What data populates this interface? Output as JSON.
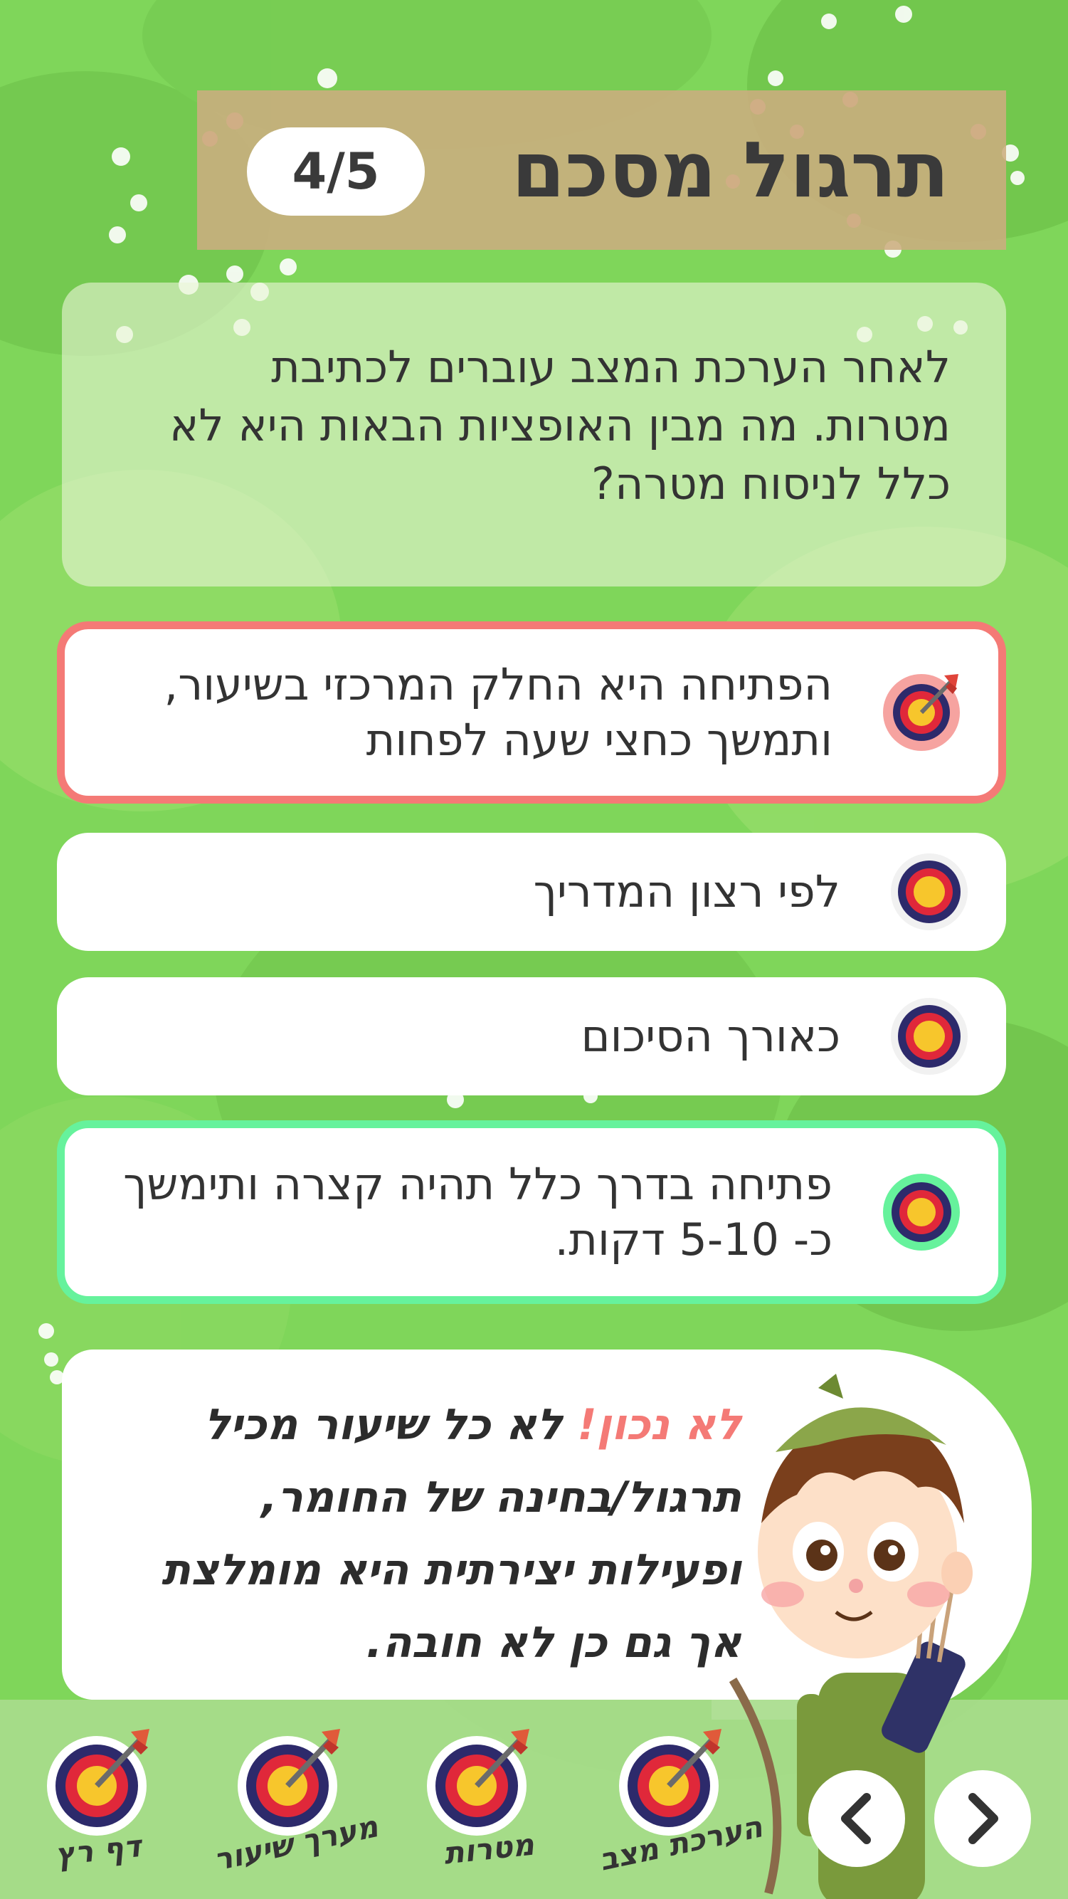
{
  "header": {
    "title": "תרגול מסכם",
    "progress": "4/5"
  },
  "question": {
    "text": "לאחר הערכת המצב עוברים לכתיבת מטרות. מה מבין האופציות הבאות היא לא כלל לניסוח מטרה?"
  },
  "answers": [
    {
      "text": "הפתיחה היא החלק המרכזי בשיעור, ותמשך כחצי שעה לפחות",
      "state": "wrong",
      "icon": "target-with-arrow-icon"
    },
    {
      "text": "לפי רצון המדריך",
      "state": "neutral",
      "icon": "target-icon"
    },
    {
      "text": "כאורך הסיכום",
      "state": "neutral",
      "icon": "target-icon"
    },
    {
      "text": "פתיחה בדרך כלל תהיה קצרה ותימשך כ- 5-10 דקות.",
      "state": "correct",
      "icon": "target-icon"
    }
  ],
  "feedback": {
    "wrong_label": "לא נכון!",
    "line1": " לא כל שיעור מכיל",
    "line2": "תרגול/בחינה של החומר,",
    "line3": "ופעילות יצירתית היא מומלצת",
    "line4": "אך גם כן לא חובה."
  },
  "nav": {
    "items": [
      {
        "label": "הערכת מצב",
        "icon": "target-with-arrow-icon"
      },
      {
        "label": "מטרות",
        "icon": "target-with-arrow-icon"
      },
      {
        "label": "מערך שיעור",
        "icon": "target-with-arrow-icon"
      },
      {
        "label": "דף רץ",
        "icon": "target-with-arrow-icon"
      }
    ],
    "next_icon": "chevron-right-icon",
    "prev_icon": "chevron-left-icon"
  },
  "colors": {
    "wrong": "#f47a76",
    "correct": "#66f29c",
    "banner": "#ccad80",
    "background": "#7fd65a",
    "target_outer": "#2d2a6b",
    "target_mid": "#e0283a",
    "target_inner": "#f7c62c"
  }
}
